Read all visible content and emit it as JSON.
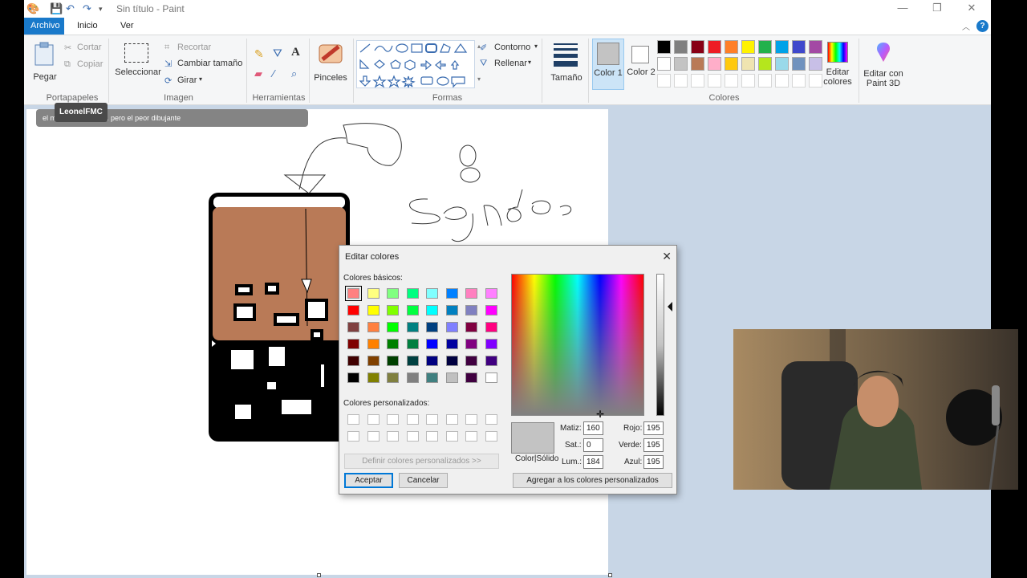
{
  "window": {
    "title": "Sin título - Paint",
    "controls": [
      "—",
      "❐",
      "✕"
    ]
  },
  "tabs": [
    {
      "label": "Archivo"
    },
    {
      "label": "Inicio"
    },
    {
      "label": "Ver"
    }
  ],
  "ribbon": {
    "clipboard": {
      "paste": "Pegar",
      "cut": "Cortar",
      "copy": "Copiar",
      "group": "Portapapeles"
    },
    "image": {
      "select": "Seleccionar",
      "crop": "Recortar",
      "resize": "Cambiar tamaño",
      "rotate": "Girar",
      "group": "Imagen"
    },
    "tools": {
      "group": "Herramientas"
    },
    "brushes": {
      "label": "Pinceles"
    },
    "shapes": {
      "outline": "Contorno",
      "fill": "Rellenar",
      "group": "Formas"
    },
    "size": {
      "label": "Tamaño"
    },
    "colors": {
      "color1": "Color 1",
      "color2": "Color 2",
      "edit": "Editar colores",
      "paint3d": "Editar con Paint 3D",
      "group": "Colores",
      "color1_value": "#c3c3c3",
      "color2_value": "#ffffff",
      "palette_row1": [
        "#000000",
        "#7f7f7f",
        "#880015",
        "#ed1c24",
        "#ff7f27",
        "#fff200",
        "#22b14c",
        "#00a2e8",
        "#3f48cc",
        "#a349a4"
      ],
      "palette_row2": [
        "#ffffff",
        "#c3c3c3",
        "#b97a57",
        "#ffaec9",
        "#ffc90e",
        "#efe4b0",
        "#b5e61d",
        "#99d9ea",
        "#7092be",
        "#c8bfe7"
      ]
    }
  },
  "overlay": {
    "user": "LeonelFMC",
    "message": "el mejor bar tendeer. pero el peor dibujante"
  },
  "dialog": {
    "title": "Editar colores",
    "basic_label": "Colores básicos:",
    "custom_label": "Colores personalizados:",
    "define_button": "Definir colores personalizados >>",
    "ok": "Aceptar",
    "cancel": "Cancelar",
    "add_custom": "Agregar a los colores personalizados",
    "preview_label": "Color|Sólido",
    "hue_label": "Matiz:",
    "sat_label": "Sat.:",
    "lum_label": "Lum.:",
    "red_label": "Rojo:",
    "green_label": "Verde:",
    "blue_label": "Azul:",
    "hue": "160",
    "sat": "0",
    "lum": "184",
    "red": "195",
    "green": "195",
    "blue": "195",
    "basic_colors": [
      "#ff8080",
      "#ffff80",
      "#80ff80",
      "#00ff80",
      "#80ffff",
      "#0080ff",
      "#ff80c0",
      "#ff80ff",
      "#ff0000",
      "#ffff00",
      "#80ff00",
      "#00ff40",
      "#00ffff",
      "#0080c0",
      "#8080c0",
      "#ff00ff",
      "#804040",
      "#ff8040",
      "#00ff00",
      "#008080",
      "#004080",
      "#8080ff",
      "#800040",
      "#ff0080",
      "#800000",
      "#ff8000",
      "#008000",
      "#008040",
      "#0000ff",
      "#0000a0",
      "#800080",
      "#8000ff",
      "#400000",
      "#804000",
      "#004000",
      "#004040",
      "#000080",
      "#000040",
      "#400040",
      "#400080",
      "#000000",
      "#808000",
      "#808040",
      "#808080",
      "#408080",
      "#c0c0c0",
      "#400040",
      "#ffffff"
    ]
  }
}
